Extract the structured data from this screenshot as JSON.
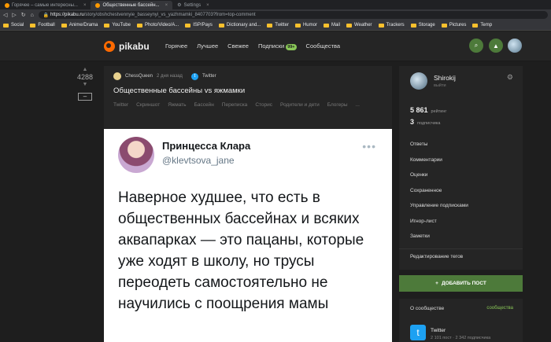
{
  "browser": {
    "tabs": [
      {
        "label": "Горячее – самые интересны..."
      },
      {
        "label": "Общественные бассейн..."
      },
      {
        "label": "Settings"
      }
    ],
    "url_host": "https://pikabu.ru",
    "url_path": "/story/obshchestvennyie_basseynyi_vs_yazhmamki_8407703?from=top-comment",
    "bookmarks": [
      "Social",
      "Football",
      "Anime/Drama",
      "YouTube",
      "Photo/Video/A...",
      "ISP/Pays",
      "Dictionary and...",
      "Twitter",
      "Humor",
      "Mail",
      "Weather",
      "Trackers",
      "Storage",
      "Pictures",
      "Temp"
    ]
  },
  "header": {
    "logo_text": "pikabu",
    "nav": [
      {
        "label": "Горячее"
      },
      {
        "label": "Лучшее"
      },
      {
        "label": "Свежее"
      },
      {
        "label": "Подписки",
        "badge": "99+"
      },
      {
        "label": "Сообщества"
      }
    ]
  },
  "post": {
    "rating": "4288",
    "author": "ChessQueen",
    "time": "2 дня назад",
    "source": "Twitter",
    "title": "Общественные бассейны vs яжмамки",
    "tags": [
      "Twitter",
      "Скриншот",
      "Яжмать",
      "Бассейн",
      "Переписка",
      "Сторис",
      "Родители и дети",
      "Блогеры",
      "..."
    ]
  },
  "tweet": {
    "name": "Принцесса Клара",
    "handle": "@klevtsova_jane",
    "text": "Наверное худшее, что есть в общественных бассейнах и всяких аквапарках — это пацаны, которые уже ходят в школу, но трусы переодеть самостоятельно не научились с поощрения мамы"
  },
  "sidebar": {
    "username": "Shirokij",
    "logout": "выйти",
    "rating_value": "5 861",
    "rating_label": "рейтинг",
    "subs_value": "3",
    "subs_label": "подписчика",
    "menu": [
      "Ответы",
      "Комментарии",
      "Оценки",
      "Сохраненное",
      "Управление подписками",
      "Игнор-лист",
      "Заметки"
    ],
    "edit_tags": "Редактирование тегов",
    "add_post": "ДОБАВИТЬ ПОСТ"
  },
  "community": {
    "header": "О сообществе",
    "link": "сообщества",
    "name": "Twitter",
    "stats": "2 101 пост · 2 342 подписчика"
  },
  "colors": {
    "accent_green": "#4d7a3a",
    "twitter_blue": "#1da1f2",
    "logo_orange": "#ff6a00"
  }
}
